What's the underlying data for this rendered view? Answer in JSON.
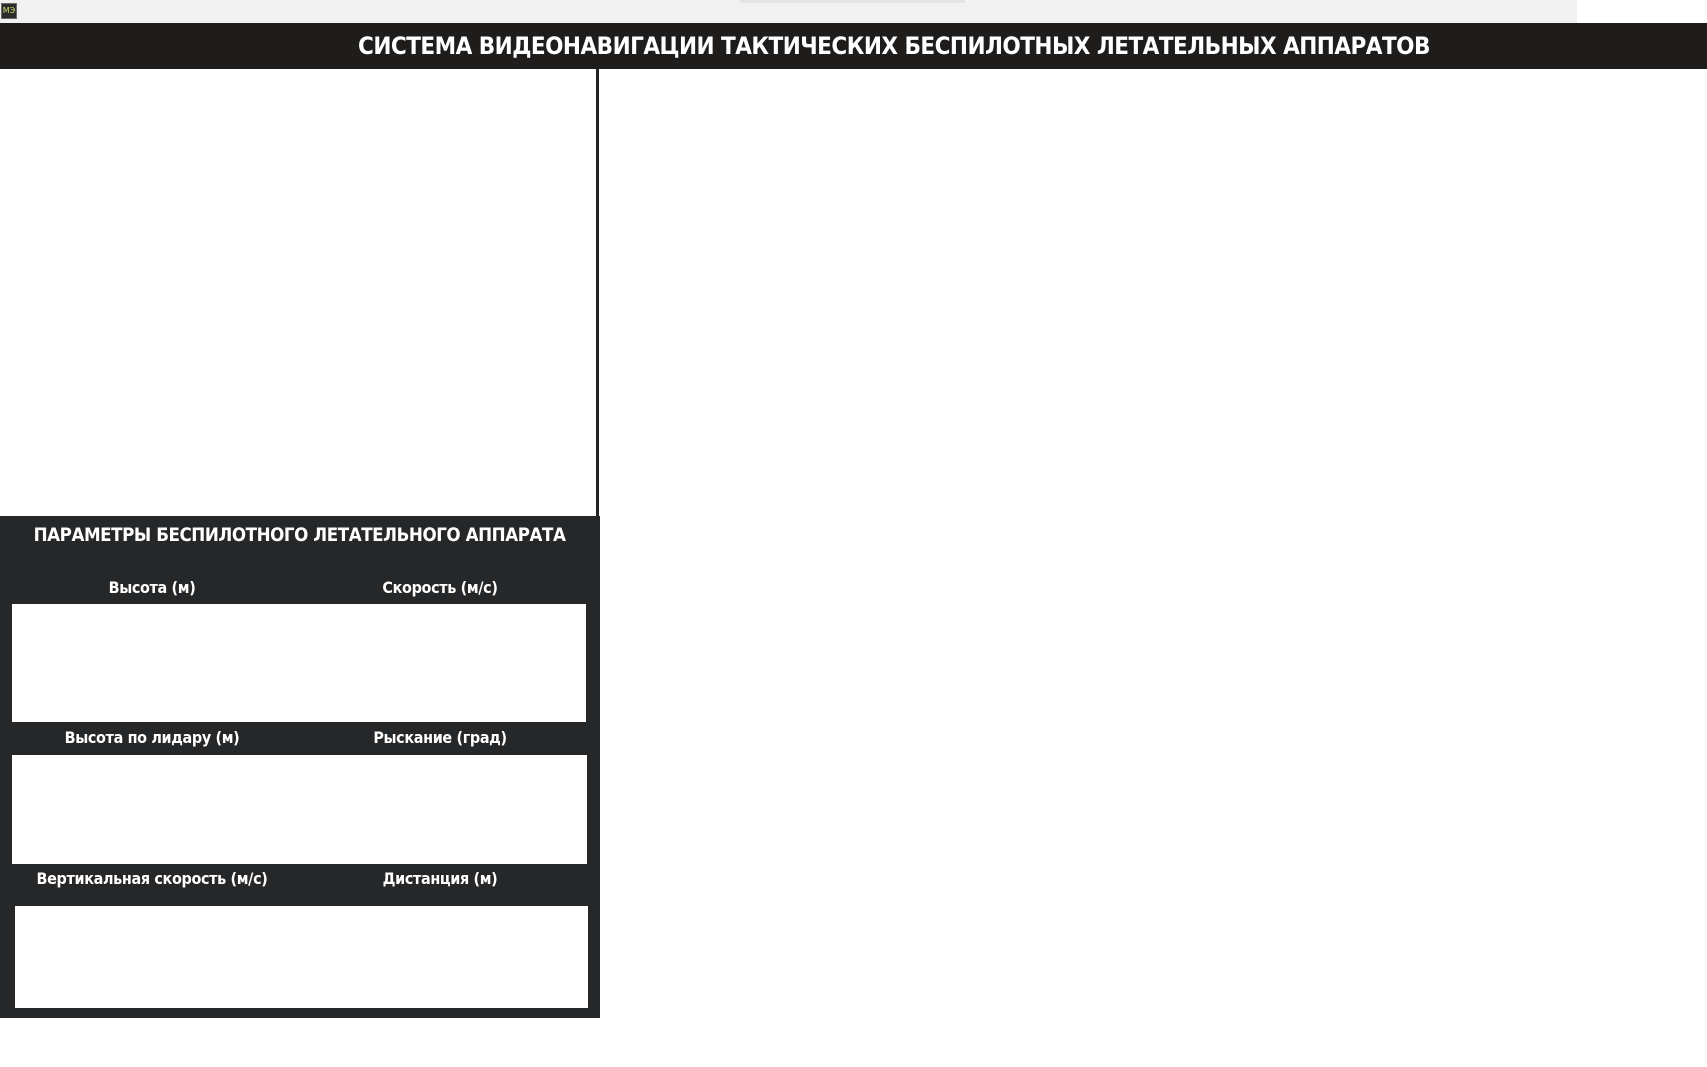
{
  "app": {
    "icon": "app-logo-icon",
    "title": "СИСТЕМА ВИДЕОНАВИГАЦИИ ТАКТИЧЕСКИХ БЕСПИЛОТНЫХ ЛЕТАТЕЛЬНЫХ АППАРАТОВ"
  },
  "colors": {
    "title_bar": "#1f1d1c",
    "panel": "#262729",
    "window_strip": "#f1f1f1"
  },
  "params": {
    "title": "ПАРАМЕТРЫ БЕСПИЛОТНОГО ЛЕТАТЕЛЬНОГО АППАРАТА",
    "rows": [
      {
        "left_label": "Высота (м)",
        "right_label": "Скорость (м/с)",
        "left_value": "",
        "right_value": ""
      },
      {
        "left_label": "Высота по лидару (м)",
        "right_label": "Рыскание (град)",
        "left_value": "",
        "right_value": ""
      },
      {
        "left_label": "Вертикальная скорость  (м/с)",
        "right_label": "Дистанция (м)",
        "left_value": "",
        "right_value": ""
      }
    ]
  }
}
